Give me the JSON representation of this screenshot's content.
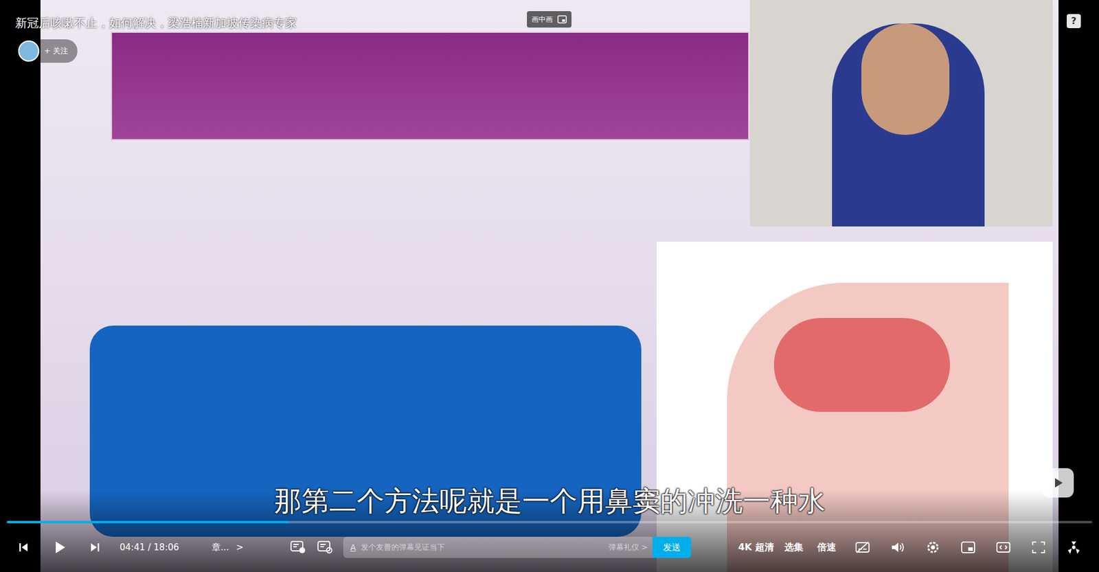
{
  "video": {
    "title": "新冠后咳嗽不止，如何解决，梁浩楠新加坡传染病专家",
    "follow": "+ 关注",
    "pip": "画中画",
    "help": "?"
  },
  "subtitle": "那第二个方法呢就是一个用鼻窦的冲洗一种水",
  "progress": {
    "level": 0.259
  },
  "controls": {
    "playing": false,
    "time": "04:41 / 18:06",
    "chapter": "章...",
    "chapter_arrow": ">",
    "danmaku_style": "A",
    "danmaku_placeholder": "发个友善的弹幕见证当下",
    "etiquette": "弹幕礼仪 >",
    "send": "发送",
    "quality": "4K 超清",
    "episodes": "选集",
    "speed": "倍速"
  }
}
